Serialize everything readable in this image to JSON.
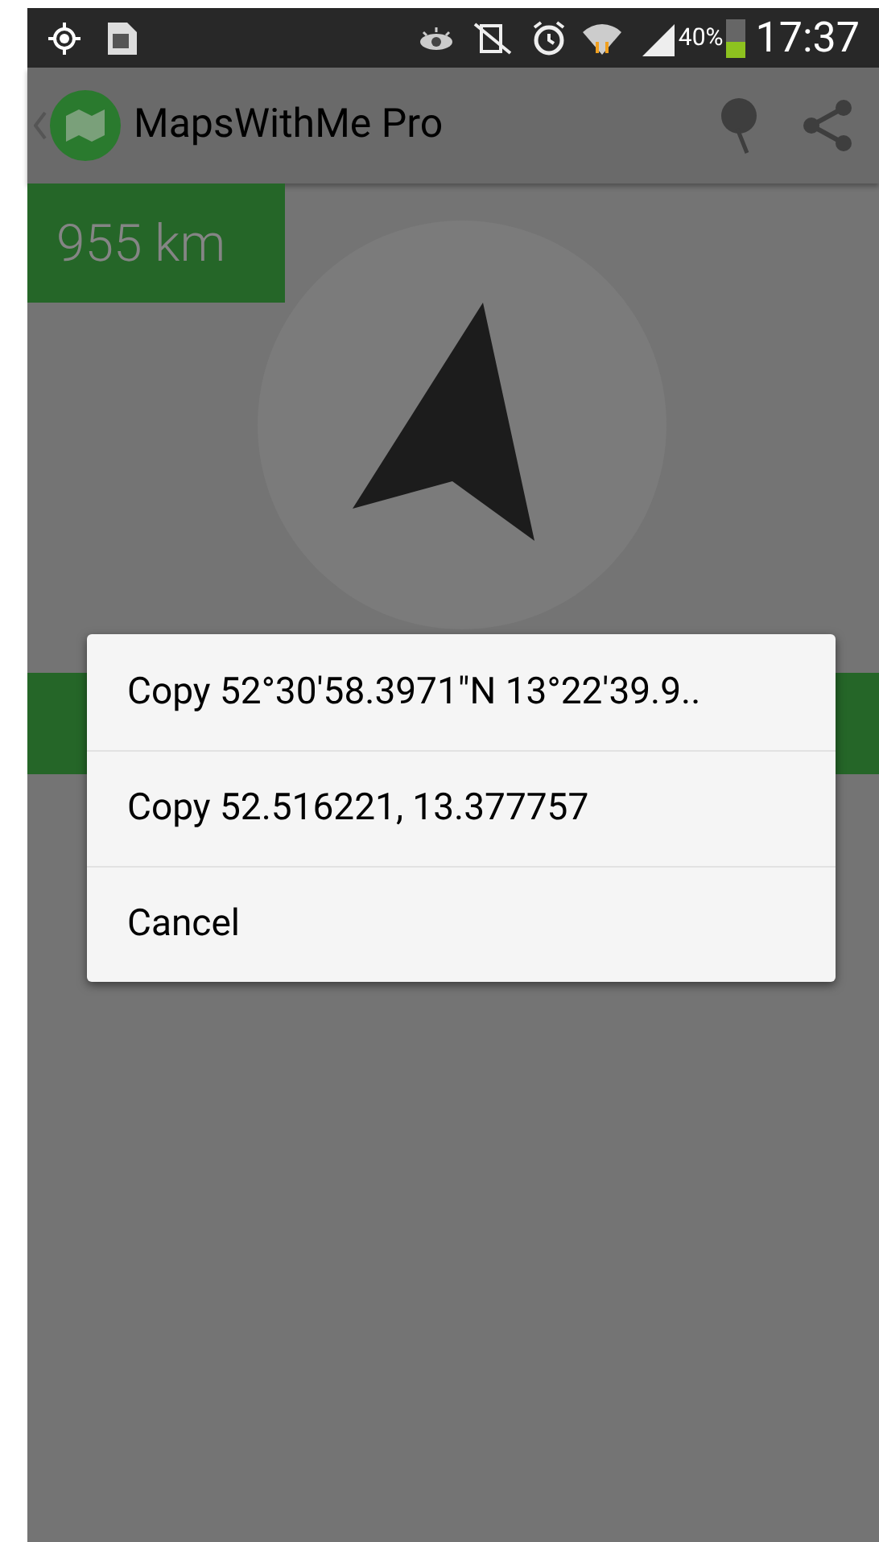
{
  "status_bar": {
    "battery_percent": "40%",
    "time": "17:37"
  },
  "action_bar": {
    "title": "MapsWithMe Pro"
  },
  "distance": {
    "text": "955 km"
  },
  "dialog": {
    "items": [
      {
        "label": "Copy 52°30′58.3971″N 13°22′39.9.."
      },
      {
        "label": "Copy 52.516221, 13.377757"
      },
      {
        "label": "Cancel"
      }
    ]
  }
}
